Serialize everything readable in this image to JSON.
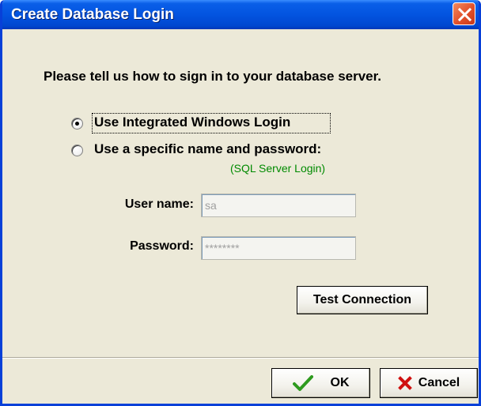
{
  "window": {
    "title": "Create Database Login"
  },
  "prompt": "Please tell us how to sign in to your database server.",
  "auth_options": [
    {
      "label": "Use Integrated Windows Login",
      "selected": true
    },
    {
      "label": "Use a specific name and password:",
      "selected": false,
      "note": "(SQL Server Login)"
    }
  ],
  "fields": {
    "username": {
      "label": "User name:",
      "value": "sa"
    },
    "password": {
      "label": "Password:",
      "value": "********"
    }
  },
  "buttons": {
    "test_connection": "Test Connection",
    "ok": "OK",
    "cancel": "Cancel"
  },
  "colors": {
    "title_bar": "#0354E0",
    "dialog_bg": "#ECE9D8",
    "close_button": "#E2502A",
    "note_text": "#008A00",
    "ok_check": "#2E9A1E",
    "cancel_x": "#D01010"
  }
}
